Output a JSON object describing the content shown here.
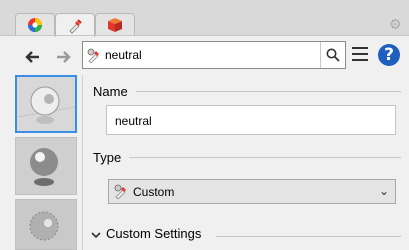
{
  "tabs": [
    {
      "icon": "color-wheel-icon"
    },
    {
      "icon": "eyedropper-icon",
      "active": true
    },
    {
      "icon": "render-box-icon"
    }
  ],
  "nav": {
    "back_icon": "back-arrow-icon",
    "forward_icon": "forward-arrow-icon",
    "path_value": "neutral",
    "search_icon": "search-icon",
    "menu_icon": "hamburger-menu-icon",
    "help_label": "?"
  },
  "properties": {
    "name_label": "Name",
    "name_value": "neutral",
    "type_label": "Type",
    "type_value": "Custom",
    "custom_settings_label": "Custom Settings"
  }
}
